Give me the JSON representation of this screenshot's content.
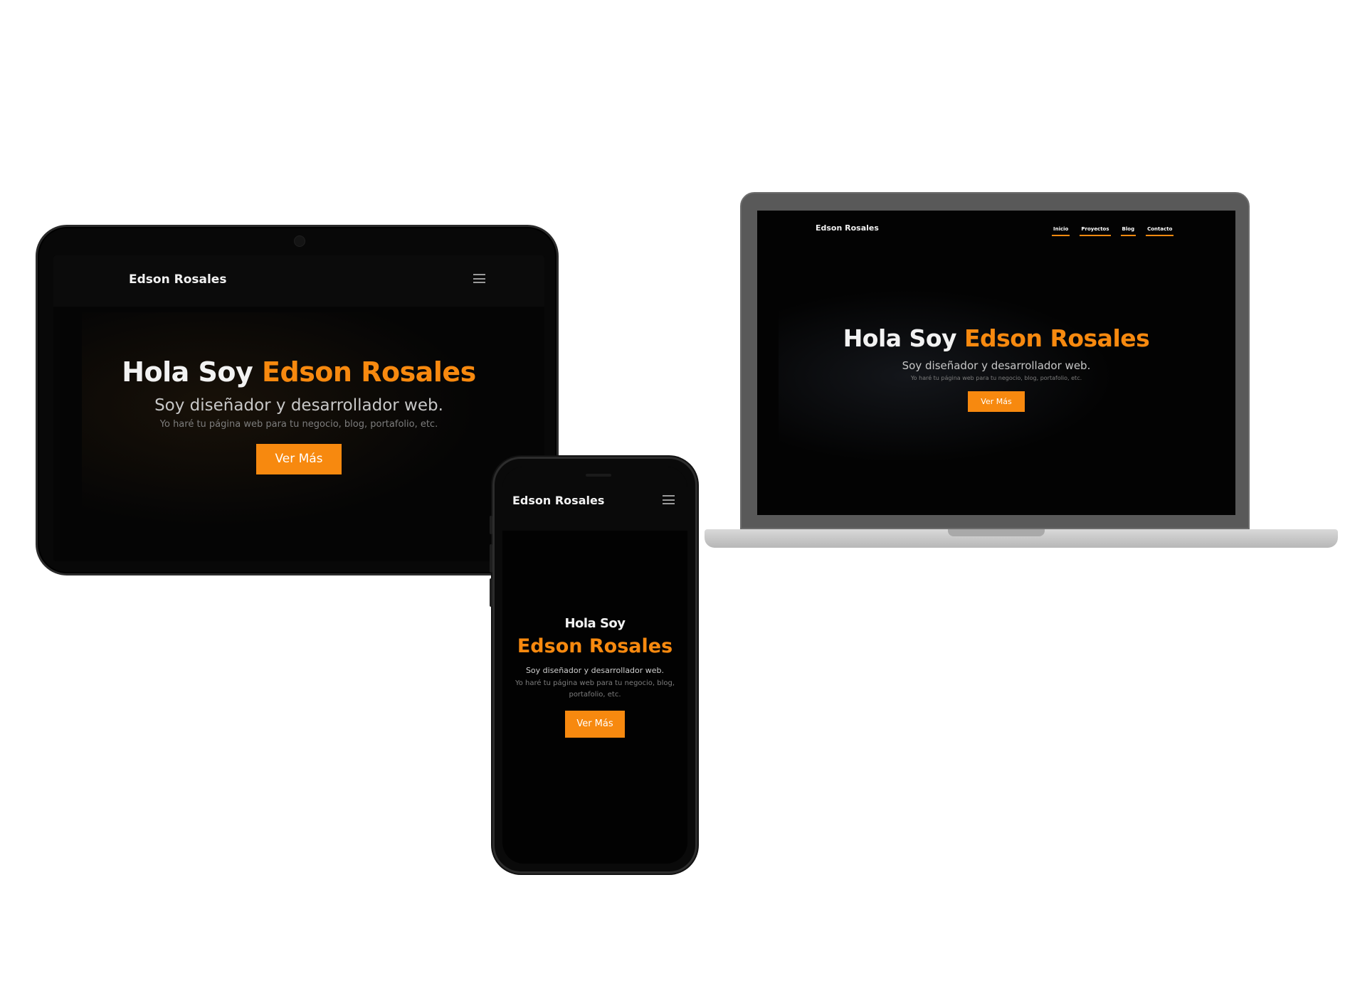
{
  "site": {
    "brand": "Edson Rosales",
    "hero_intro": "Hola Soy",
    "hero_name": "Edson Rosales",
    "subtitle": "Soy diseñador y desarrollador web.",
    "tagline": "Yo haré tu página web para tu negocio, blog, portafolio, etc.",
    "cta_label": "Ver Más",
    "nav_links": [
      "Inicio",
      "Proyectos",
      "Blog",
      "Contacto"
    ]
  },
  "theme": {
    "accent": "#f7890f",
    "background": "#050505",
    "text": "#f2f2f2"
  },
  "icons": {
    "menu": "hamburger-menu-icon"
  }
}
